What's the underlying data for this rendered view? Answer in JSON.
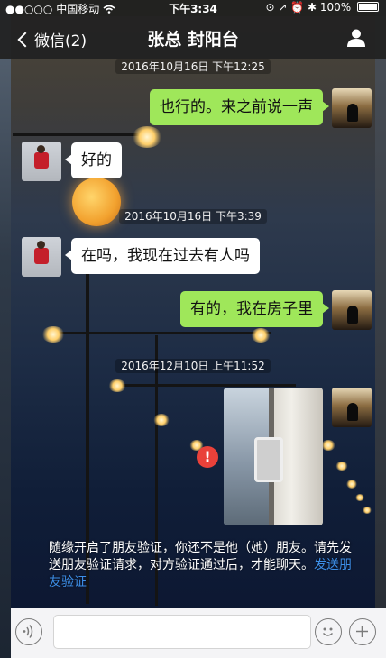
{
  "status_bar": {
    "signal": "●●○○○",
    "carrier": "中国移动",
    "time": "下午3:34",
    "right_icons": "⊙ ↗ ⏰ ✱",
    "battery_pct": "100%"
  },
  "nav": {
    "back_label": "微信(2)",
    "title": "张总  封阳台",
    "right_icon": "person-icon"
  },
  "messages": [
    {
      "type": "time",
      "text": "2016年10月16日 下午12:25"
    },
    {
      "type": "text",
      "from": "me",
      "text": "也行的。来之前说一声"
    },
    {
      "type": "text",
      "from": "them",
      "text": "好的"
    },
    {
      "type": "time",
      "text": "2016年10月16日 下午3:39"
    },
    {
      "type": "text",
      "from": "them",
      "text": "在吗，我现在过去有人吗"
    },
    {
      "type": "text",
      "from": "me",
      "text": "有的，我在房子里"
    },
    {
      "type": "time",
      "text": "2016年12月10日 上午11:52"
    },
    {
      "type": "image",
      "from": "me",
      "status": "send-failed"
    }
  ],
  "system_notice": {
    "text": "随缘开启了朋友验证，你还不是他（她）朋友。请先发送朋友验证请求，对方验证通过后，才能聊天。",
    "link_text": "发送朋友验证"
  },
  "input_bar": {
    "value": "",
    "icons": [
      "voice-icon",
      "emoji-icon",
      "plus-icon"
    ]
  },
  "colors": {
    "my_bubble": "#9fe75a",
    "their_bubble": "#ffffff",
    "link": "#3d8fe8",
    "error": "#e9413a"
  }
}
